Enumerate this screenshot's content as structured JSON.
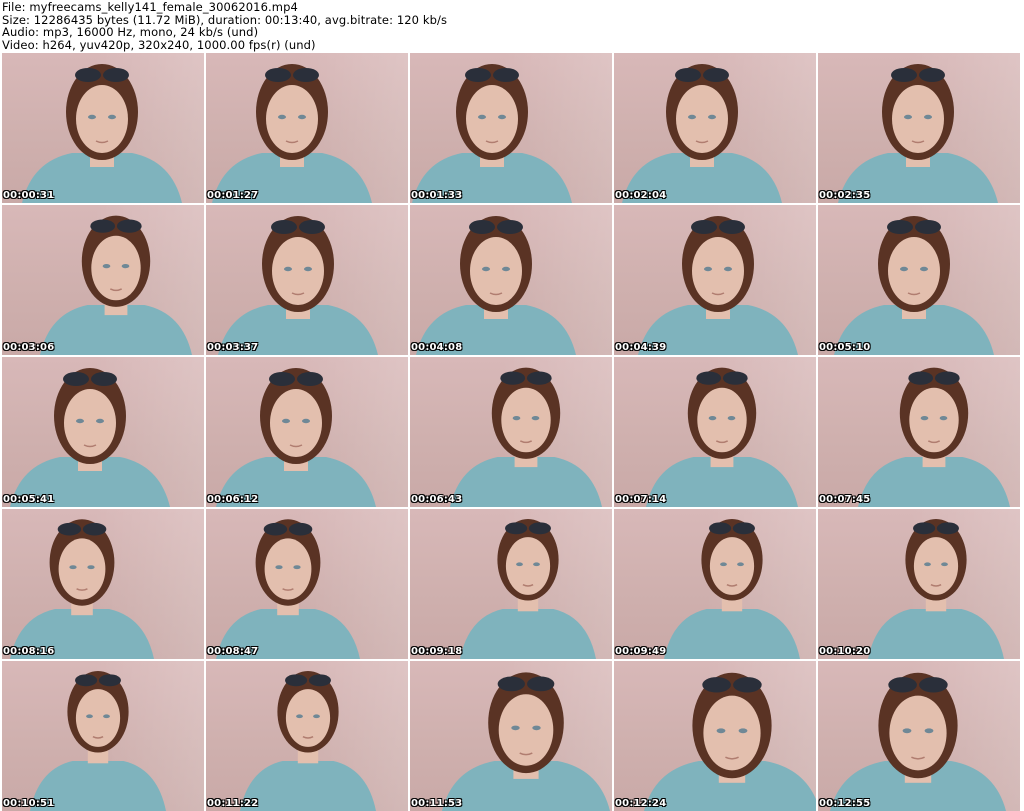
{
  "header": {
    "file_line": "File: myfreecams_kelly141_female_30062016.mp4",
    "size_line": "Size: 12286435 bytes (11.72 MiB), duration: 00:13:40, avg.bitrate: 120 kb/s",
    "audio_line": "Audio: mp3, 16000 Hz, mono, 24 kb/s (und)",
    "video_line": "Video: h264, yuv420p, 320x240, 1000.00 fps(r) (und)"
  },
  "thumbnails": [
    {
      "timestamp": "00:00:31"
    },
    {
      "timestamp": "00:01:27"
    },
    {
      "timestamp": "00:01:33"
    },
    {
      "timestamp": "00:02:04"
    },
    {
      "timestamp": "00:02:35"
    },
    {
      "timestamp": "00:03:06"
    },
    {
      "timestamp": "00:03:37"
    },
    {
      "timestamp": "00:04:08"
    },
    {
      "timestamp": "00:04:39"
    },
    {
      "timestamp": "00:05:10"
    },
    {
      "timestamp": "00:05:41"
    },
    {
      "timestamp": "00:06:12"
    },
    {
      "timestamp": "00:06:43"
    },
    {
      "timestamp": "00:07:14"
    },
    {
      "timestamp": "00:07:45"
    },
    {
      "timestamp": "00:08:16"
    },
    {
      "timestamp": "00:08:47"
    },
    {
      "timestamp": "00:09:18"
    },
    {
      "timestamp": "00:09:49"
    },
    {
      "timestamp": "00:10:20"
    },
    {
      "timestamp": "00:10:51"
    },
    {
      "timestamp": "00:11:22"
    },
    {
      "timestamp": "00:11:53"
    },
    {
      "timestamp": "00:12:24"
    },
    {
      "timestamp": "00:12:55"
    }
  ],
  "colors": {
    "wall": "#d3b3b1",
    "shirt": "#7fb3bd",
    "hair": "#5a3324",
    "skin": "#e3bfae",
    "sunglasses": "#2a2f3a"
  }
}
